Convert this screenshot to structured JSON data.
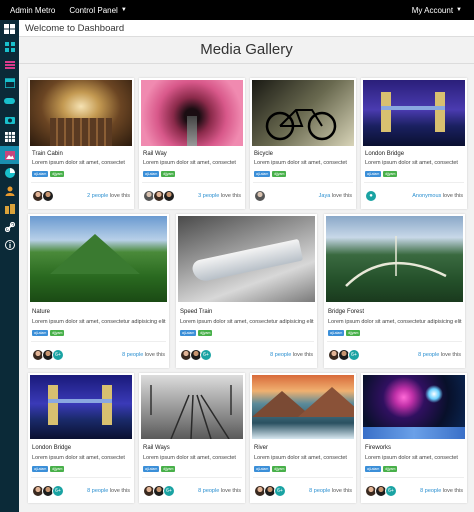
{
  "topbar": {
    "brand": "Admin Metro",
    "menu": "Control Panel",
    "account": "My Account"
  },
  "welcome": "Welcome to Dashboard",
  "page_title": "Media Gallery",
  "sidebar": {
    "items": [
      {
        "icon": "windows-icon"
      },
      {
        "icon": "grid-icon"
      },
      {
        "icon": "list-icon"
      },
      {
        "icon": "calendar-icon"
      },
      {
        "icon": "gamepad-icon"
      },
      {
        "icon": "camera-icon"
      },
      {
        "icon": "table-icon"
      },
      {
        "icon": "image-icon"
      },
      {
        "icon": "pie-chart-icon"
      },
      {
        "icon": "user-icon"
      },
      {
        "icon": "building-icon"
      },
      {
        "icon": "link-icon"
      },
      {
        "icon": "info-icon"
      }
    ],
    "active_index": 7
  },
  "tag_labels": {
    "blue": "ajLaiam",
    "green": "djjyam"
  },
  "cards": [
    {
      "name": "Train Cabin",
      "desc": "Lorem ipsum dolor sit amet, consectet",
      "love_who": "2 people",
      "love_suffix": "love this",
      "extra": ""
    },
    {
      "name": "Rail Way",
      "desc": "Lorem ipsum dolor sit amet, consectet",
      "love_who": "3 people",
      "love_suffix": "love this",
      "extra": ""
    },
    {
      "name": "Bicycle",
      "desc": "Lorem ipsum dolor sit amet, consectet",
      "love_who": "Jaya",
      "love_suffix": "love this",
      "extra": ""
    },
    {
      "name": "London Bridge",
      "desc": "Lorem ipsum dolor sit amet, consectet",
      "love_who": "Anonymous",
      "love_suffix": "love this",
      "extra": ""
    },
    {
      "name": "Nature",
      "desc": "Lorem ipsum dolor sit amet, consectetur adipisicing elit",
      "love_who": "8 people",
      "love_suffix": "love this",
      "extra": "6+"
    },
    {
      "name": "Speed Train",
      "desc": "Lorem ipsum dolor sit amet, consectetur adipisicing elit",
      "love_who": "8 people",
      "love_suffix": "love this",
      "extra": "6+"
    },
    {
      "name": "Bridge Forest",
      "desc": "Lorem ipsum dolor sit amet, consectetur adipisicing elit",
      "love_who": "8 people",
      "love_suffix": "love this",
      "extra": "6+"
    },
    {
      "name": "London Bridge",
      "desc": "Lorem ipsum dolor sit amet, consectet",
      "love_who": "8 people",
      "love_suffix": "love this",
      "extra": "6+"
    },
    {
      "name": "Rail Ways",
      "desc": "Lorem ipsum dolor sit amet, consectet",
      "love_who": "8 people",
      "love_suffix": "love this",
      "extra": "6+"
    },
    {
      "name": "River",
      "desc": "Lorem ipsum dolor sit amet, consectet",
      "love_who": "8 people",
      "love_suffix": "love this",
      "extra": "6+"
    },
    {
      "name": "Fireworks",
      "desc": "Lorem ipsum dolor sit amet, consectet",
      "love_who": "8 people",
      "love_suffix": "love this",
      "extra": "6+"
    }
  ]
}
